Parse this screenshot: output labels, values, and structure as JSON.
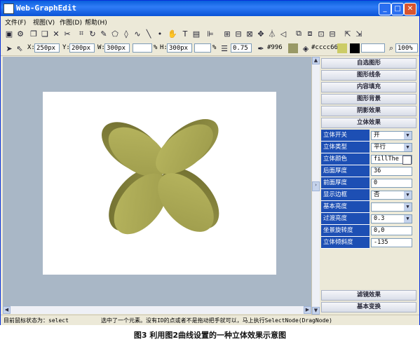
{
  "window": {
    "title": "Web-GraphEdit"
  },
  "menu": [
    "文件(F)",
    "视图(V)",
    "作图(D)",
    "帮助(H)"
  ],
  "toolbar2": {
    "x_label": "X:",
    "x_value": "250px",
    "y_label": "Y:",
    "y_value": "200px",
    "w_label": "W:",
    "w_value": "300px",
    "h_label": "H:",
    "h_value": "300px",
    "pct1": "%",
    "pct2": "%",
    "stroke_width": "0.75",
    "stroke_color": "#996",
    "fill_color": "#cccc66",
    "zoom": "100%"
  },
  "panel": {
    "top_sections": [
      "自选图形",
      "图形线条",
      "内容填充",
      "图形背景",
      "阴影效果",
      "立体效果"
    ],
    "rows": [
      {
        "label": "立体开关",
        "value": "开",
        "dropdown": true
      },
      {
        "label": "立体类型",
        "value": "平行",
        "dropdown": true
      },
      {
        "label": "立体颜色",
        "value": "fillThe",
        "dropdown": false
      },
      {
        "label": "后面厚度",
        "value": "36",
        "dropdown": false
      },
      {
        "label": "前面厚度",
        "value": "0",
        "dropdown": false
      },
      {
        "label": "显示边框",
        "value": "否",
        "dropdown": true
      },
      {
        "label": "基本亮度",
        "value": "",
        "dropdown": true
      },
      {
        "label": "过渡亮度",
        "value": "0.3",
        "dropdown": true
      },
      {
        "label": "坐景旋转度",
        "value": "0,0",
        "dropdown": false
      },
      {
        "label": "立体倾斜度",
        "value": "-135",
        "dropdown": false
      }
    ],
    "bottom_sections": [
      "滤镜效果",
      "基本变换"
    ]
  },
  "status": {
    "left": "目前鼠标状态为：select",
    "right": "选中了一个元素。没有ID的点或者不是拖动把手就可以，马上执行SelectNode(DragNode)"
  },
  "caption": "图3  利用图2曲线设置的一种立体效果示意图",
  "colors": {
    "shape_front": "#a8a851",
    "shape_side": "#7f7d3c",
    "accent": "#1d4fb4"
  }
}
